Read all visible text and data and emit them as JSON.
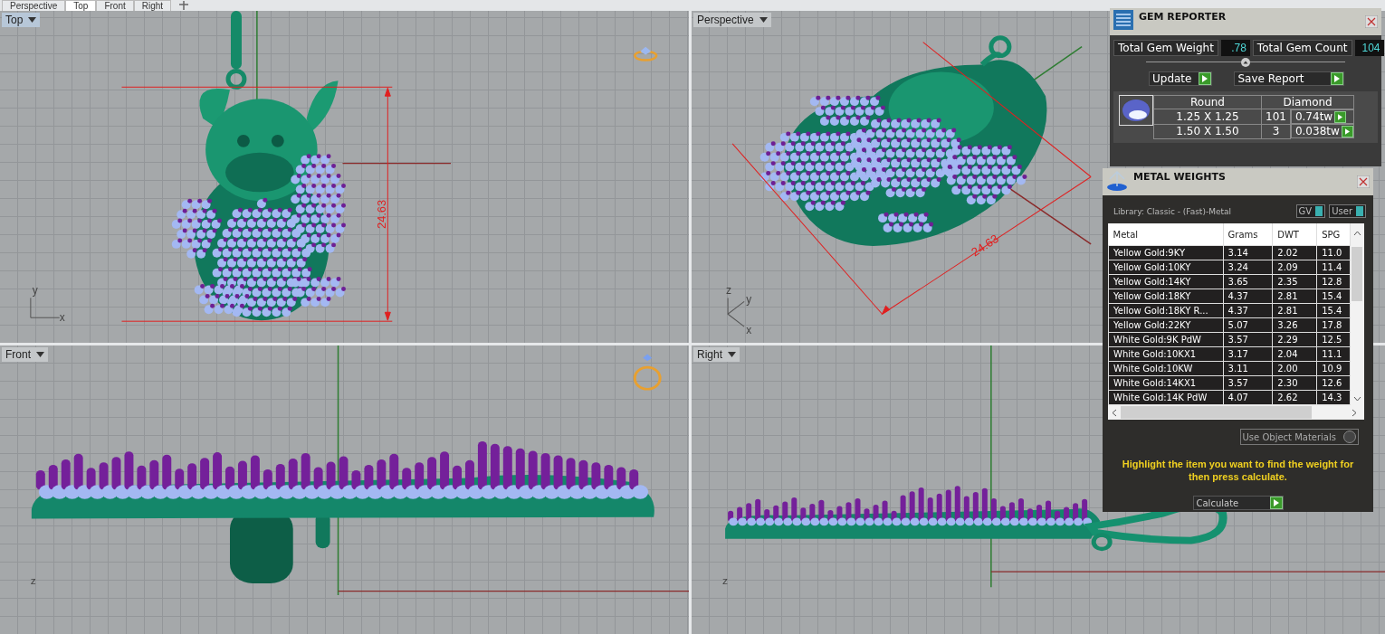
{
  "tabs": [
    {
      "label": "Perspective",
      "selected": false
    },
    {
      "label": "Top",
      "selected": true
    },
    {
      "label": "Front",
      "selected": false
    },
    {
      "label": "Right",
      "selected": false
    }
  ],
  "viewports": [
    {
      "title": "Top",
      "kind": "top",
      "active": true,
      "dimension": "24.63",
      "axes": [
        "y",
        "x"
      ]
    },
    {
      "title": "Perspective",
      "kind": "perspective",
      "active": false,
      "dimension": "24.63",
      "axes": [
        "z",
        "y",
        "x"
      ]
    },
    {
      "title": "Front",
      "kind": "front",
      "active": false,
      "axes": [
        "z"
      ]
    },
    {
      "title": "Right",
      "kind": "right",
      "active": false,
      "axes": [
        "z"
      ]
    }
  ],
  "gem_reporter": {
    "title": "GEM REPORTER",
    "weight_label": "Total Gem Weight",
    "weight": ".78",
    "count_label": "Total Gem Count",
    "count": "104",
    "buttons": [
      "Update",
      "Save Report"
    ],
    "columns": [
      "Round",
      "Diamond"
    ],
    "rows": [
      {
        "size": "1.25 X 1.25",
        "count": "101",
        "weight": "0.74tw"
      },
      {
        "size": "1.50 X 1.50",
        "count": "3",
        "weight": "0.038tw"
      }
    ]
  },
  "metal_weights": {
    "title": "METAL WEIGHTS",
    "library": "Library: Classic - (Fast)-Metal",
    "toggles": [
      {
        "label": "GV",
        "on": true
      },
      {
        "label": "User",
        "on": true
      }
    ],
    "columns": [
      "Metal",
      "Grams",
      "DWT",
      "SPG"
    ],
    "rows": [
      [
        "Yellow Gold:9KY",
        "3.14",
        "2.02",
        "11.0"
      ],
      [
        "Yellow Gold:10KY",
        "3.24",
        "2.09",
        "11.4"
      ],
      [
        "Yellow Gold:14KY",
        "3.65",
        "2.35",
        "12.8"
      ],
      [
        "Yellow Gold:18KY",
        "4.37",
        "2.81",
        "15.4"
      ],
      [
        "Yellow Gold:18KY R...",
        "4.37",
        "2.81",
        "15.4"
      ],
      [
        "Yellow Gold:22KY",
        "5.07",
        "3.26",
        "17.8"
      ],
      [
        "White Gold:9K PdW",
        "3.57",
        "2.29",
        "12.5"
      ],
      [
        "White Gold:10KX1",
        "3.17",
        "2.04",
        "11.1"
      ],
      [
        "White Gold:10KW",
        "3.11",
        "2.00",
        "10.9"
      ],
      [
        "White Gold:14KX1",
        "3.57",
        "2.30",
        "12.6"
      ],
      [
        "White Gold:14K PdW",
        "4.07",
        "2.62",
        "14.3"
      ]
    ],
    "use_object_materials": {
      "label": "Use Object Materials",
      "checked": false
    },
    "hint": "Highlight the item you want to find the weight for then press calculate.",
    "button": "Calculate"
  }
}
